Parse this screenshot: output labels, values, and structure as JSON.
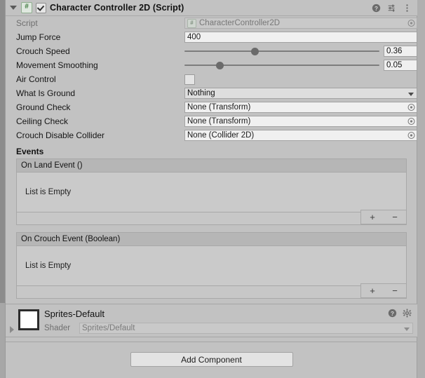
{
  "component": {
    "title": "Character Controller 2D (Script)",
    "enabled": true,
    "script_icon": "#",
    "header_icons": [
      "help-icon",
      "preset-icon",
      "more-menu-icon"
    ]
  },
  "properties": [
    {
      "label": "Script",
      "type": "object",
      "value": "CharacterController2D",
      "disabled": true,
      "icon": "#"
    },
    {
      "label": "Jump Force",
      "type": "number",
      "value": "400"
    },
    {
      "label": "Crouch Speed",
      "type": "slider",
      "value": "0.36",
      "fill_percent": 36
    },
    {
      "label": "Movement Smoothing",
      "type": "slider",
      "value": "0.05",
      "fill_percent": 18
    },
    {
      "label": "Air Control",
      "type": "checkbox",
      "checked": false
    },
    {
      "label": "What Is Ground",
      "type": "dropdown",
      "value": "Nothing"
    },
    {
      "label": "Ground Check",
      "type": "object",
      "value": "None (Transform)"
    },
    {
      "label": "Ceiling Check",
      "type": "object",
      "value": "None (Transform)"
    },
    {
      "label": "Crouch Disable Collider",
      "type": "object",
      "value": "None (Collider 2D)"
    }
  ],
  "events": {
    "title": "Events",
    "add_label": "+",
    "remove_label": "−",
    "list": [
      {
        "header": "On Land Event ()",
        "empty_text": "List is Empty"
      },
      {
        "header": "On Crouch Event (Boolean)",
        "empty_text": "List is Empty"
      }
    ]
  },
  "material": {
    "name": "Sprites-Default",
    "shader_label": "Shader",
    "shader_value": "Sprites/Default",
    "icons": [
      "help-icon",
      "gear-icon"
    ]
  },
  "footer": {
    "add_component_label": "Add Component"
  },
  "colors": {
    "background": "#c2c2c2",
    "field": "#f0f0f0",
    "border": "#a2a2a2",
    "script_green": "#3f7a3f",
    "text": "#151515",
    "dim_text": "#6f6f6f"
  }
}
